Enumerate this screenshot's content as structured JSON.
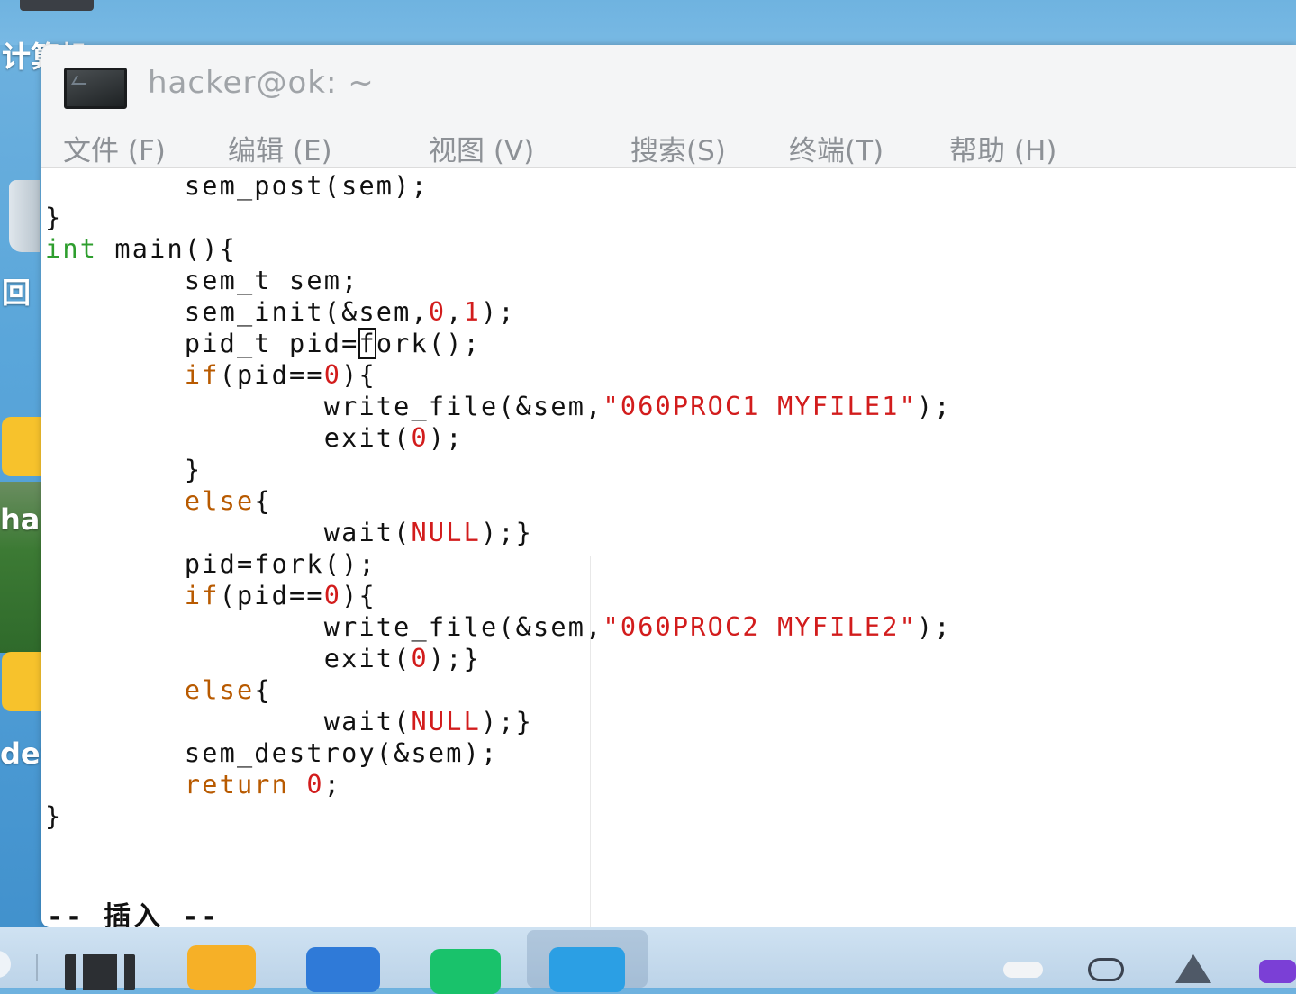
{
  "desktop": {
    "labels": [
      "计算机",
      "回",
      "ha",
      "dev"
    ]
  },
  "window": {
    "title": "hacker@ok: ~",
    "menu": [
      "文件 (F)",
      "编辑 (E)",
      "视图 (V)",
      "搜索(S)",
      "终端(T)",
      "帮助 (H)"
    ]
  },
  "editor": {
    "mode_line": "-- 插入 --",
    "tilde": "~",
    "lines": [
      "        sem_post(sem);",
      "}",
      "int main(){",
      "        sem_t sem;",
      "        sem_init(&sem,0,1);",
      "        pid_t pid=fork();",
      "        if(pid==0){",
      "                write_file(&sem,\"060PROC1 MYFILE1\");",
      "                exit(0);",
      "        }",
      "        else{",
      "                wait(NULL);}",
      "        pid=fork();",
      "        if(pid==0){",
      "                write_file(&sem,\"060PROC2 MYFILE2\");",
      "                exit(0);}",
      "        else{",
      "                wait(NULL);}",
      "        sem_destroy(&sem);",
      "        return 0;",
      "}"
    ]
  },
  "taskbar": {
    "apps": [
      "file-manager-icon",
      "vpn-icon",
      "wps-icon",
      "chat-icon",
      "stack-app-icon"
    ],
    "tray": [
      "cloud-icon",
      "audio-wave-icon",
      "network-icon",
      "screen-record-icon"
    ]
  },
  "colors": {
    "type_keyword": "#2e9e2e",
    "keyword": "#b85a00",
    "literal": "#d21c1c"
  }
}
